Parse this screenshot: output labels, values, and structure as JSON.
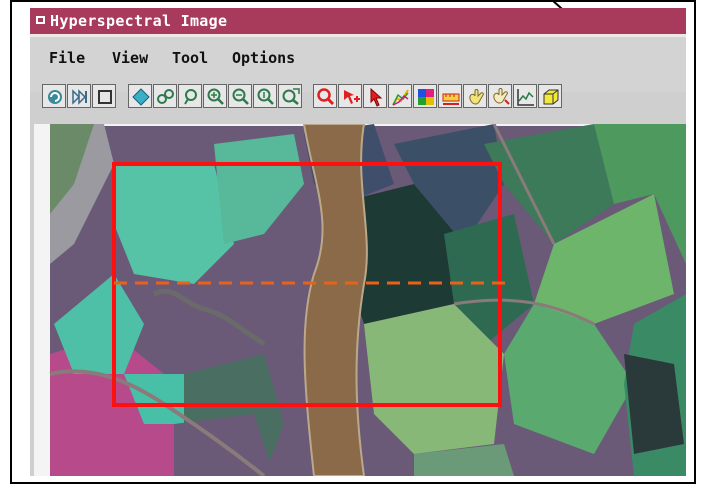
{
  "window": {
    "title": "Hyperspectral Image"
  },
  "menu": {
    "file": "File",
    "view": "View",
    "tool": "Tool",
    "options": "Options"
  },
  "colors": {
    "titlebar": "#a83a5c",
    "selection_box": "#ff1010",
    "profile_line": "#e8621a",
    "river": "#8a6a48"
  },
  "toolbar_icons": [
    "refresh-icon",
    "skip-forward-icon",
    "stop-icon",
    "diamond-icon",
    "zoom-group-icon",
    "zoom-back-icon",
    "zoom-in-icon",
    "zoom-out-icon",
    "zoom-actual-icon",
    "zoom-extent-icon",
    "magnify-red-icon",
    "cursor-red-icon",
    "select-arrow-icon",
    "spectral-plot-icon",
    "color-grid-icon",
    "ruler-icon",
    "hand-icon",
    "hand-pan-icon",
    "profile-chart-icon",
    "cube-icon"
  ]
}
